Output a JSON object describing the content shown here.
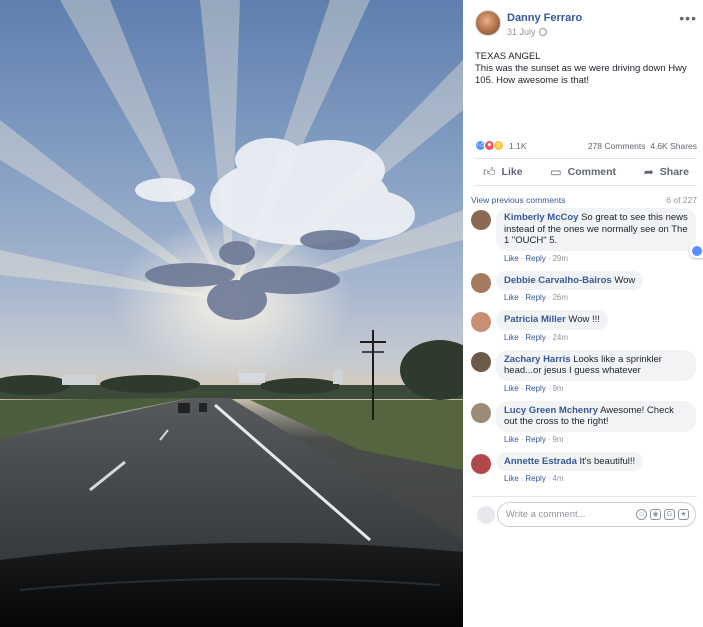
{
  "photo": {
    "alt_icon": "photo-sunset-angel-cloud"
  },
  "post": {
    "author": "Danny Ferraro",
    "date": "31 July",
    "privacy_icon": "globe-icon",
    "more_label": "•••",
    "text_line1": "TEXAS ANGEL",
    "text_line2": "This was the sunset as we were driving down Hwy 105. How awesome is that!"
  },
  "stats": {
    "reactions": "1.1K",
    "comments": "278 Comments",
    "shares": "4.6K Shares"
  },
  "actions": {
    "like": "Like",
    "comment": "Comment",
    "share": "Share"
  },
  "comments_header": {
    "view_previous": "View previous comments",
    "count": "6 of 227"
  },
  "comments": [
    {
      "name": "Kimberly McCoy",
      "text": "So great to see this news instead of the ones we normally see on The 1 \"OUCH\" 5.",
      "like": "Like",
      "reply": "Reply",
      "time": "29m",
      "reactions": "1",
      "avatar_color": "#8a6a55"
    },
    {
      "name": "Debbie Carvalho-Bairos",
      "text": "Wow",
      "like": "Like",
      "reply": "Reply",
      "time": "26m",
      "avatar_color": "#a47b5e"
    },
    {
      "name": "Patricia Miller",
      "text": "Wow !!!",
      "like": "Like",
      "reply": "Reply",
      "time": "24m",
      "avatar_color": "#c98e74"
    },
    {
      "name": "Zachary Harris",
      "text": "Looks like a sprinkler head...or jesus I guess whatever",
      "like": "Like",
      "reply": "Reply",
      "time": "9m",
      "avatar_color": "#6b5b4b"
    },
    {
      "name": "Lucy Green Mchenry",
      "text": "Awesome! Check out the cross to the right!",
      "like": "Like",
      "reply": "Reply",
      "time": "9m",
      "avatar_color": "#9c8b78"
    },
    {
      "name": "Annette Estrada",
      "text": "It's beautiful!!",
      "like": "Like",
      "reply": "Reply",
      "time": "4m",
      "avatar_color": "#b04a4a"
    }
  ],
  "writer": {
    "placeholder": "Write a comment..."
  },
  "colors": {
    "link": "#365899",
    "muted": "#90949c",
    "like_blue": "#5890ff"
  }
}
